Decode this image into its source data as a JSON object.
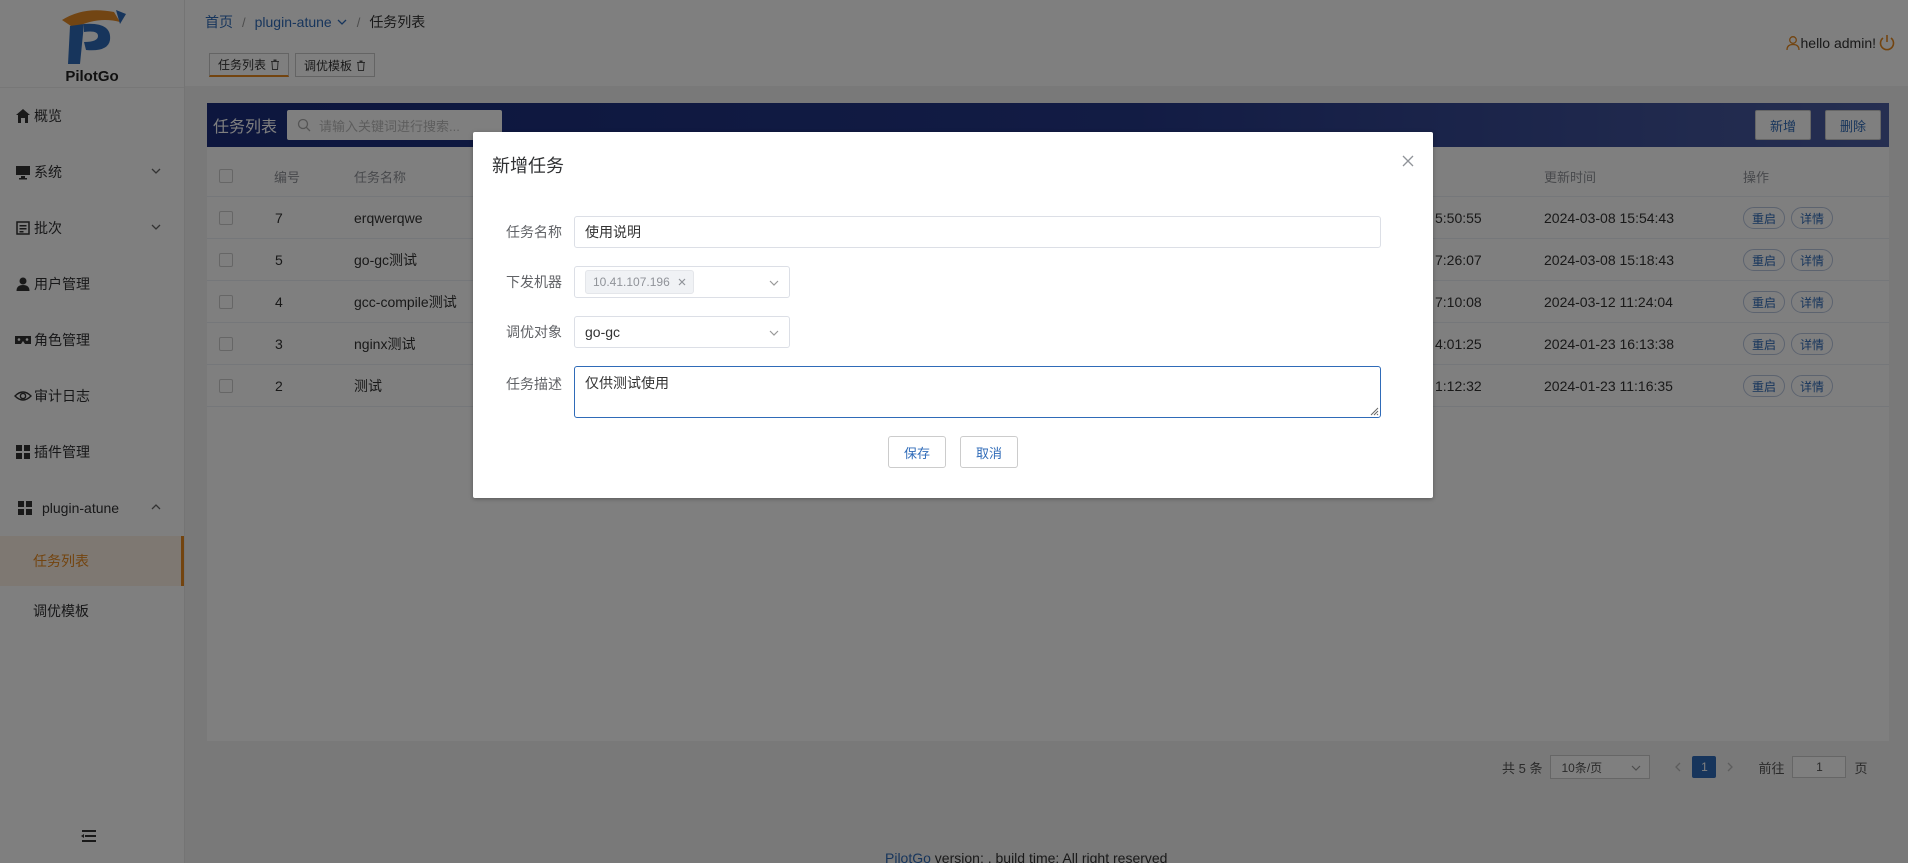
{
  "app": {
    "logo_text": "PilotGo"
  },
  "sidebar": {
    "items": [
      {
        "label": "概览",
        "icon": "home-icon"
      },
      {
        "label": "系统",
        "icon": "monitor-icon",
        "expandable": true
      },
      {
        "label": "批次",
        "icon": "batch-icon",
        "expandable": true
      },
      {
        "label": "用户管理",
        "icon": "user-icon"
      },
      {
        "label": "角色管理",
        "icon": "role-icon"
      },
      {
        "label": "审计日志",
        "icon": "eye-icon"
      },
      {
        "label": "插件管理",
        "icon": "grid-icon"
      },
      {
        "label": "plugin-atune",
        "icon": "grid-icon",
        "expanded": true
      }
    ],
    "subitems": [
      {
        "label": "任务列表",
        "active": true
      },
      {
        "label": "调优模板",
        "active": false
      }
    ]
  },
  "breadcrumb": {
    "home": "首页",
    "plugin": "plugin-atune",
    "current": "任务列表"
  },
  "user": {
    "greeting": "hello admin!"
  },
  "tags": [
    {
      "label": "任务列表",
      "active": true
    },
    {
      "label": "调优模板",
      "active": false
    }
  ],
  "card": {
    "title": "任务列表",
    "search_placeholder": "请输入关键词进行搜索...",
    "add_label": "新增",
    "delete_label": "删除"
  },
  "table": {
    "headers": {
      "id": "编号",
      "name": "任务名称",
      "updated": "更新时间",
      "ops": "操作"
    },
    "rows": [
      {
        "id": "7",
        "name": "erqwerqwe",
        "created_tail": "5:50:55",
        "updated": "2024-03-08 15:54:43"
      },
      {
        "id": "5",
        "name": "go-gc测试",
        "created_tail": "7:26:07",
        "updated": "2024-03-08 15:18:43"
      },
      {
        "id": "4",
        "name": "gcc-compile测试",
        "created_tail": "7:10:08",
        "updated": "2024-03-12 11:24:04"
      },
      {
        "id": "3",
        "name": "nginx测试",
        "created_tail": "4:01:25",
        "updated": "2024-01-23 16:13:38"
      },
      {
        "id": "2",
        "name": "测试",
        "created_tail": "1:12:32",
        "updated": "2024-01-23 11:16:35"
      }
    ],
    "restart_label": "重启",
    "detail_label": "详情"
  },
  "pagination": {
    "total": "共 5 条",
    "page_size": "10条/页",
    "current_page": "1",
    "goto_label": "前往",
    "goto_value": "1",
    "page_suffix": "页"
  },
  "footer": {
    "brand": "PilotGo",
    "text": " version: , build time: All right reserved"
  },
  "dialog": {
    "title": "新增任务",
    "fields": {
      "task_name_label": "任务名称",
      "task_name_value": "使用说明",
      "machine_label": "下发机器",
      "machine_chip": "10.41.107.196",
      "target_label": "调优对象",
      "target_value": "go-gc",
      "desc_label": "任务描述",
      "desc_value": "仅供测试使用"
    },
    "save_label": "保存",
    "cancel_label": "取消"
  },
  "colors": {
    "accent": "#e6881e",
    "primary": "#2f6bb8",
    "header_gradient_start": "#1a2d7c"
  }
}
